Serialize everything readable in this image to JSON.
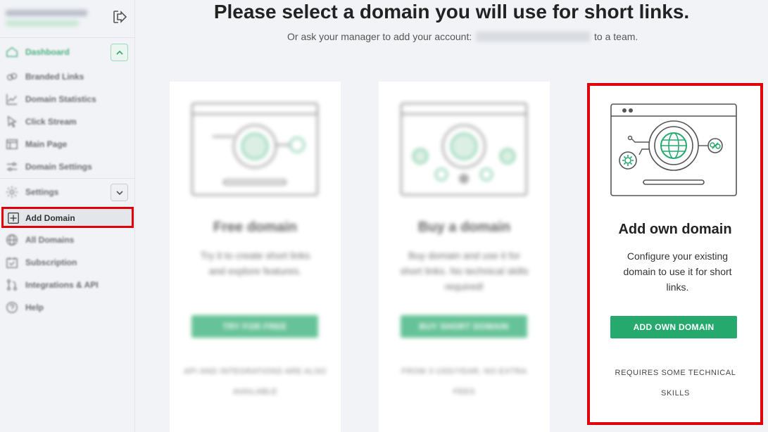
{
  "sidebar": {
    "items": [
      {
        "label": "Dashboard",
        "icon": "home-icon"
      },
      {
        "label": "Branded Links",
        "icon": "link-icon"
      },
      {
        "label": "Domain Statistics",
        "icon": "chart-icon"
      },
      {
        "label": "Click Stream",
        "icon": "cursor-icon"
      },
      {
        "label": "Main Page",
        "icon": "layout-icon"
      },
      {
        "label": "Domain Settings",
        "icon": "sliders-icon"
      },
      {
        "label": "Settings",
        "icon": "gear-icon"
      },
      {
        "label": "Add Domain",
        "icon": "plus-square-icon"
      },
      {
        "label": "All Domains",
        "icon": "globe-icon"
      },
      {
        "label": "Subscription",
        "icon": "calendar-icon"
      },
      {
        "label": "Integrations & API",
        "icon": "branch-icon"
      },
      {
        "label": "Help",
        "icon": "help-icon"
      }
    ]
  },
  "header": {
    "title": "Please select a domain you will use for short links.",
    "subtitle_before": "Or ask your manager to add your account:",
    "subtitle_after": "to a team."
  },
  "cards": [
    {
      "title": "Free domain",
      "description": "Try it to create short links and explore features.",
      "button": "TRY FOR FREE",
      "note": "API AND INTEGRATIONS ARE ALSO AVAILABLE"
    },
    {
      "title": "Buy a domain",
      "description": "Buy domain and use it for short links. No technical skills required!",
      "button": "BUY SHORT DOMAIN",
      "note": "FROM 3 USD/YEAR, NO EXTRA FEES"
    },
    {
      "title": "Add own domain",
      "description": "Configure your existing domain to use it for short links.",
      "button": "ADD OWN DOMAIN",
      "note": "REQUIRES SOME TECHNICAL SKILLS"
    }
  ],
  "colors": {
    "accent": "#26a96d",
    "highlight": "#e0000a"
  }
}
